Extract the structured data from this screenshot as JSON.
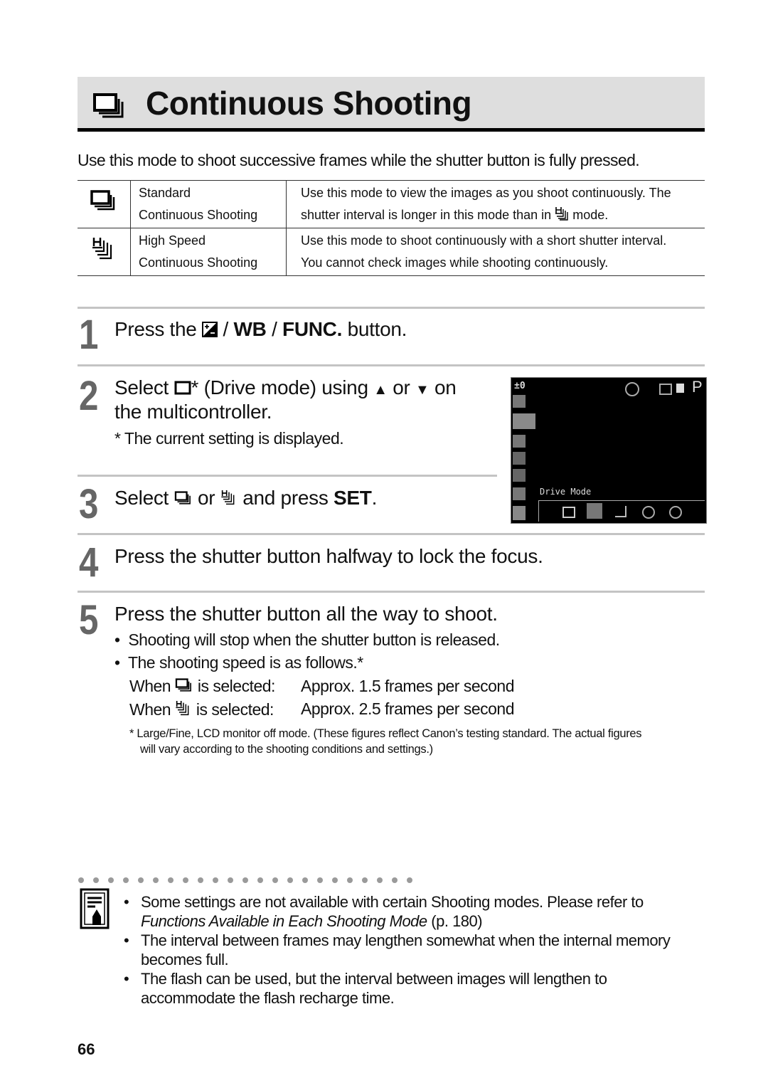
{
  "header": {
    "icon": "continuous-shooting-icon",
    "title": "Continuous Shooting"
  },
  "intro": "Use this mode to shoot successive frames while the shutter button is fully pressed.",
  "modes_table": {
    "rows": [
      {
        "icon": "continuous-shooting-icon",
        "name_line1": "Standard",
        "name_line2": "Continuous Shooting",
        "desc_line1": "Use this mode to view the images as you shoot continuously. The",
        "desc_line2_pre": "shutter interval is longer in this mode than in",
        "desc_line2_icon": "high-speed-continuous-icon",
        "desc_line2_post": "mode."
      },
      {
        "icon": "high-speed-continuous-icon",
        "name_line1": "High Speed",
        "name_line2": "Continuous Shooting",
        "desc_line1": "Use this mode to shoot continuously with a short shutter interval.",
        "desc_line2_pre": "You cannot check images while shooting continuously."
      }
    ]
  },
  "steps": [
    {
      "number": "1",
      "text_pre": "Press the",
      "icon": "exposure-compensation-icon",
      "sep1": "/",
      "wb": "WB",
      "sep2": "/",
      "func": "FUNC.",
      "text_post": "button."
    },
    {
      "number": "2",
      "line1_pre": "Select",
      "icon": "single-shot-icon",
      "line1_mid": "* (Drive mode) using",
      "up": "▲",
      "or": "or",
      "down": "▼",
      "on": "on",
      "line2": "the multicontroller.",
      "note": "* The current setting is displayed."
    },
    {
      "number": "3",
      "pre": "Select",
      "or": "or",
      "mid": "and press",
      "set": "SET",
      "post": "."
    },
    {
      "number": "4",
      "text": "Press the shutter button halfway to lock the focus."
    },
    {
      "number": "5",
      "text": "Press the shutter button all the way to shoot.",
      "bullets": [
        "Shooting will stop when the shutter button is released.",
        "The shooting speed is as follows.*"
      ],
      "speeds": [
        {
          "when": "When",
          "icon": "continuous-shooting-icon",
          "selected": "is selected:",
          "rate": "Approx. 1.5 frames per second"
        },
        {
          "when": "When",
          "icon": "high-speed-continuous-icon",
          "selected": "is selected:",
          "rate": "Approx. 2.5 frames per second"
        }
      ],
      "footnote_line1": "* Large/Fine, LCD monitor off mode. (These figures reflect Canon’s testing standard. The actual figures",
      "footnote_line2": "will vary according to the shooting conditions and settings.)"
    }
  ],
  "lcd_screen": {
    "exposure": "±0",
    "mode": "P",
    "menu_label": "Drive Mode",
    "options": [
      "single",
      "continuous",
      "high-speed",
      "self-timer-10s",
      "self-timer-2s"
    ],
    "selected_option": "continuous"
  },
  "notes": [
    {
      "pre": "Some settings are not available with certain Shooting modes.  Please refer to",
      "italic": "Functions Available in Each Shooting Mode",
      "post": "(p. 180)"
    },
    {
      "line1": "The interval between frames may lengthen somewhat when the internal memory",
      "line2": "becomes full."
    },
    {
      "line1": "The flash can be used, but the interval between images will lengthen to",
      "line2": "accommodate the flash recharge time."
    }
  ],
  "bullet_char": "•",
  "page_number": "66"
}
